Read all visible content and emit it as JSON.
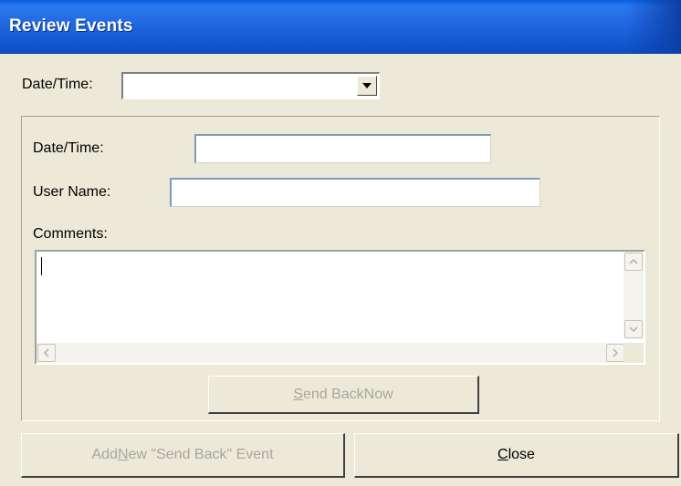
{
  "window": {
    "title": "Review Events"
  },
  "filter": {
    "datetime_label": "Date/Time:",
    "datetime_value": ""
  },
  "details": {
    "datetime_label": "Date/Time:",
    "datetime_value": "",
    "username_label": "User Name:",
    "username_value": "",
    "comments_label": "Comments:",
    "comments_value": ""
  },
  "buttons": {
    "send_back_now": {
      "pre": "",
      "accel": "S",
      "post": "end BackNow",
      "enabled": false
    },
    "add_new_event": {
      "pre": "Add ",
      "accel": "N",
      "post": "ew \"Send Back\" Event",
      "enabled": false
    },
    "close": {
      "pre": "",
      "accel": "C",
      "post": "lose",
      "enabled": true
    }
  },
  "icons": {
    "combo_arrow": "chevron-down-icon",
    "scroll_up": "up-arrow-icon",
    "scroll_down": "down-arrow-icon",
    "scroll_left": "left-arrow-icon",
    "scroll_right": "right-arrow-icon"
  }
}
